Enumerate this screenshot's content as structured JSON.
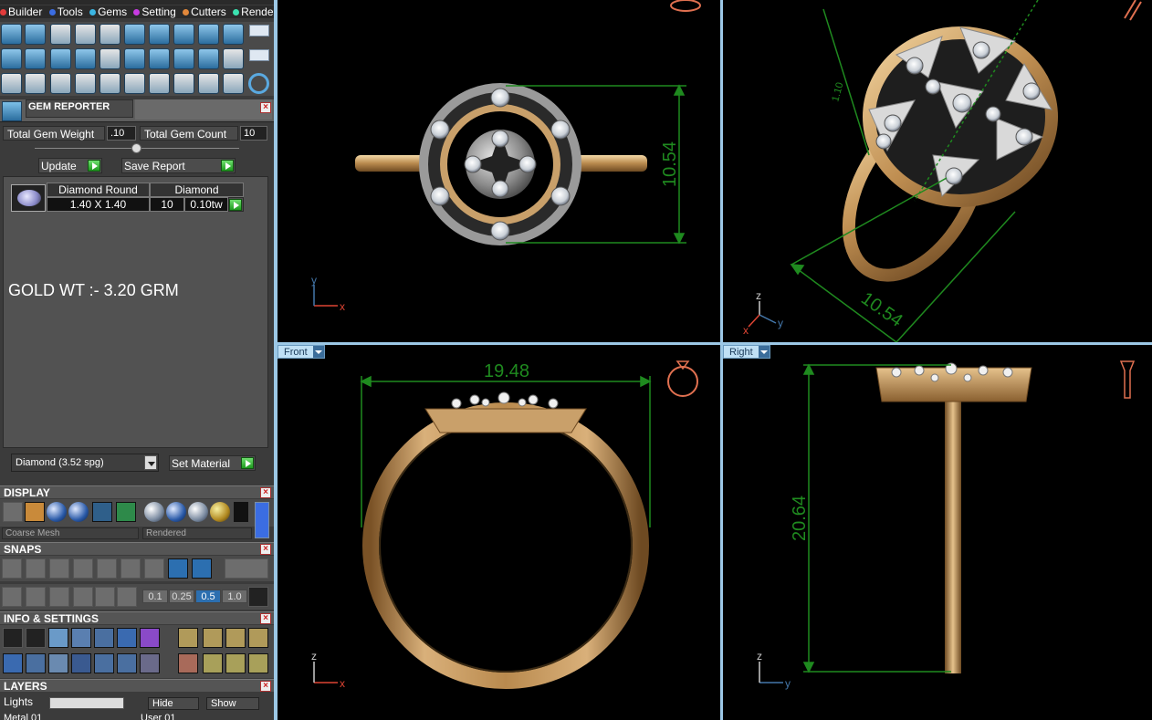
{
  "menu": {
    "items": [
      {
        "label": "Builder",
        "color": "#e23b3b"
      },
      {
        "label": "Tools",
        "color": "#3b6de2"
      },
      {
        "label": "Gems",
        "color": "#3bb5e2"
      },
      {
        "label": "Setting",
        "color": "#c83be2"
      },
      {
        "label": "Cutters",
        "color": "#e2883b"
      },
      {
        "label": "Render",
        "color": "#3be2b0"
      }
    ]
  },
  "gem_reporter": {
    "title": "GEM REPORTER",
    "total_weight_label": "Total Gem Weight",
    "total_weight_value": ".10",
    "total_count_label": "Total Gem Count",
    "total_count_value": "10",
    "update_label": "Update",
    "save_report_label": "Save Report",
    "row": {
      "shape": "Diamond Round",
      "size": "1.40 X 1.40",
      "type": "Diamond",
      "count": "10",
      "weight": "0.10tw"
    },
    "note": "GOLD WT :- 3.20 GRM",
    "material": "Diamond    (3.52 spg)",
    "set_material_label": "Set Material"
  },
  "display": {
    "title": "DISPLAY",
    "mesh_mode": "Coarse Mesh",
    "render_mode": "Rendered"
  },
  "snaps": {
    "title": "SNAPS",
    "values": [
      "0.1",
      "0.25",
      "0.5",
      "1.0"
    ],
    "active": "0.5"
  },
  "info": {
    "title": "INFO & SETTINGS"
  },
  "layers": {
    "title": "LAYERS",
    "lights_label": "Lights",
    "hide_label": "Hide",
    "show_label": "Show",
    "metal_label": "Metal 01",
    "user_label": "User 01"
  },
  "viewports": {
    "top": {
      "dimension": "10.54",
      "axis_h": "x",
      "axis_v": "y"
    },
    "perspective": {
      "dimension_a": "10.54",
      "dimension_b": "1.10",
      "axis_z": "z",
      "axis_y": "y",
      "axis_x": "x"
    },
    "front": {
      "label": "Front",
      "dimension": "19.48",
      "axis_h": "x",
      "axis_v": "z"
    },
    "right": {
      "label": "Right",
      "dimension": "20.64",
      "axis_h": "y",
      "axis_v": "z"
    }
  },
  "colors": {
    "dimension_green": "#1f8a1f",
    "gold": "#c99a5a",
    "viewport_border": "#9cc8e6"
  }
}
